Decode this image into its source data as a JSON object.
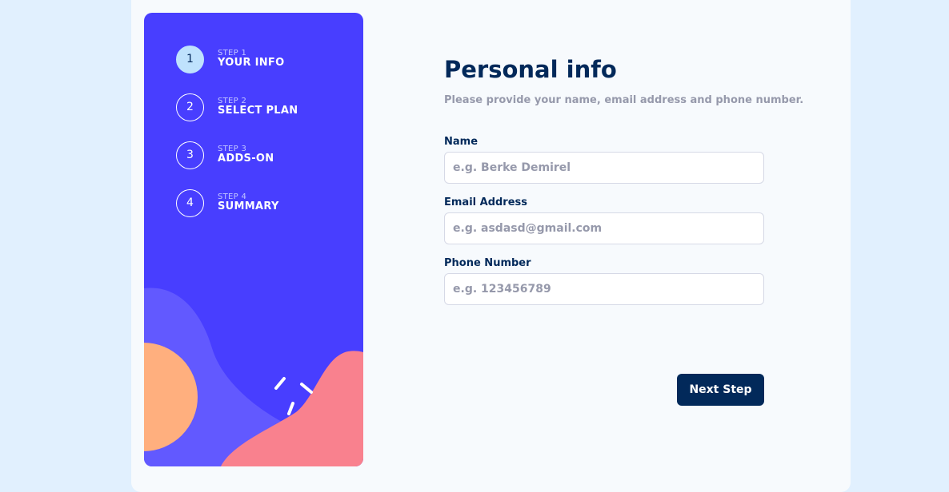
{
  "sidebar": {
    "steps": [
      {
        "number": "1",
        "small": "STEP 1",
        "label": "YOUR INFO",
        "active": true
      },
      {
        "number": "2",
        "small": "STEP 2",
        "label": "SELECT PLAN",
        "active": false
      },
      {
        "number": "3",
        "small": "STEP 3",
        "label": "ADDS-ON",
        "active": false
      },
      {
        "number": "4",
        "small": "STEP 4",
        "label": "SUMMARY",
        "active": false
      }
    ]
  },
  "form": {
    "title": "Personal info",
    "subtitle": "Please provide your name, email address and phone number.",
    "fields": {
      "name": {
        "label": "Name",
        "placeholder": "e.g. Berke Demirel",
        "value": ""
      },
      "email": {
        "label": "Email Address",
        "placeholder": "e.g. asdasd@gmail.com",
        "value": ""
      },
      "phone": {
        "label": "Phone Number",
        "placeholder": "e.g. 123456789",
        "value": ""
      }
    },
    "next_label": "Next Step"
  },
  "colors": {
    "page_background": "#e1f0fe",
    "card_background": "#f7fafd",
    "sidebar_background": "#483eff",
    "active_step": "#bfe2fd",
    "primary_dark": "#02295a",
    "muted_text": "#9699ab",
    "border": "#d6d9e6",
    "shape_orange": "#ffaf7e",
    "shape_purple": "#6259ff",
    "shape_pink": "#f9818e"
  }
}
